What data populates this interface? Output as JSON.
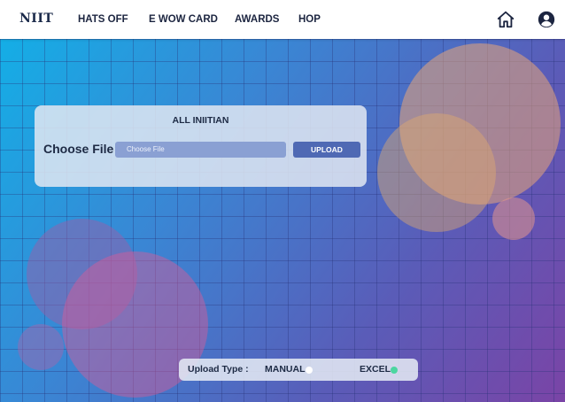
{
  "brand": {
    "logo": "NIIT"
  },
  "nav": {
    "items": [
      {
        "label": "HATS OFF"
      },
      {
        "label": "E WOW CARD"
      },
      {
        "label": "AWARDS"
      },
      {
        "label": "HOP"
      }
    ],
    "icons": [
      "home-icon",
      "user-account-icon"
    ]
  },
  "upload_card": {
    "title": "ALL INIITIAN",
    "choose_label": "Choose File :",
    "file_placeholder": "Choose File",
    "upload_label": "UPLOAD"
  },
  "upload_type": {
    "label": "Upload Type :",
    "options": [
      {
        "label": "MANUAL",
        "color": "#ffffff"
      },
      {
        "label": "EXCEL",
        "color": "#4cd6a0"
      }
    ]
  },
  "colors": {
    "nav_text": "#1c2540",
    "upload_button": "#4f69b4",
    "file_input": "#8aa0d3"
  }
}
